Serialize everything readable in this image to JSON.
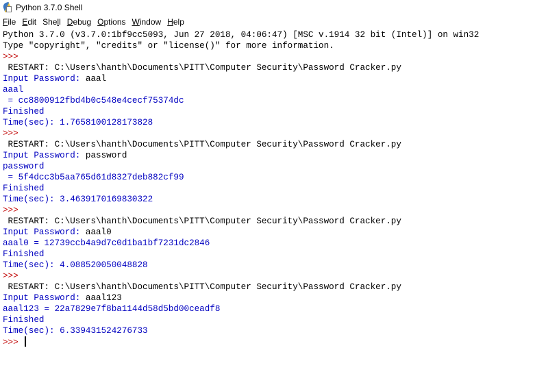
{
  "window": {
    "title": "Python 3.7.0 Shell",
    "icon": "python-idle-icon"
  },
  "menu": {
    "items": [
      {
        "pre": "",
        "key": "F",
        "post": "ile"
      },
      {
        "pre": "",
        "key": "E",
        "post": "dit"
      },
      {
        "pre": "She",
        "key": "l",
        "post": "l"
      },
      {
        "pre": "",
        "key": "D",
        "post": "ebug"
      },
      {
        "pre": "",
        "key": "O",
        "post": "ptions"
      },
      {
        "pre": "",
        "key": "W",
        "post": "indow"
      },
      {
        "pre": "",
        "key": "H",
        "post": "elp"
      }
    ]
  },
  "colors": {
    "stdout": "#0000c0",
    "prompt": "#c00000",
    "plain": "#000000",
    "background": "#ffffff"
  },
  "shell": {
    "lines": [
      {
        "text": "Python 3.7.0 (v3.7.0:1bf9cc5093, Jun 27 2018, 04:06:47) [MSC v.1914 32 bit (Intel)] on win32",
        "kind": "plain"
      },
      {
        "text": "Type \"copyright\", \"credits\" or \"license()\" for more information.",
        "kind": "plain"
      },
      {
        "text": ">>> ",
        "kind": "prompt"
      },
      {
        "text": " RESTART: C:\\Users\\hanth\\Documents\\PITT\\Computer Security\\Password Cracker.py",
        "kind": "plain"
      },
      {
        "text": "Input Password: ",
        "kind": "stdout",
        "input": "aaal"
      },
      {
        "text": "aaal",
        "kind": "stdout"
      },
      {
        "text": " = cc8800912fbd4b0c548e4cecf75374dc",
        "kind": "stdout"
      },
      {
        "text": "Finished",
        "kind": "stdout"
      },
      {
        "text": "Time(sec): 1.7658100128173828",
        "kind": "stdout"
      },
      {
        "text": ">>> ",
        "kind": "prompt"
      },
      {
        "text": " RESTART: C:\\Users\\hanth\\Documents\\PITT\\Computer Security\\Password Cracker.py",
        "kind": "plain"
      },
      {
        "text": "Input Password: ",
        "kind": "stdout",
        "input": "password"
      },
      {
        "text": "password",
        "kind": "stdout"
      },
      {
        "text": " = 5f4dcc3b5aa765d61d8327deb882cf99",
        "kind": "stdout"
      },
      {
        "text": "Finished",
        "kind": "stdout"
      },
      {
        "text": "Time(sec): 3.4639170169830322",
        "kind": "stdout"
      },
      {
        "text": ">>> ",
        "kind": "prompt"
      },
      {
        "text": " RESTART: C:\\Users\\hanth\\Documents\\PITT\\Computer Security\\Password Cracker.py",
        "kind": "plain"
      },
      {
        "text": "Input Password: ",
        "kind": "stdout",
        "input": "aaal0"
      },
      {
        "text": "aaal0 = 12739ccb4a9d7c0d1ba1bf7231dc2846",
        "kind": "stdout"
      },
      {
        "text": "Finished",
        "kind": "stdout"
      },
      {
        "text": "Time(sec): 4.088520050048828",
        "kind": "stdout"
      },
      {
        "text": ">>> ",
        "kind": "prompt"
      },
      {
        "text": " RESTART: C:\\Users\\hanth\\Documents\\PITT\\Computer Security\\Password Cracker.py",
        "kind": "plain"
      },
      {
        "text": "Input Password: ",
        "kind": "stdout",
        "input": "aaal123"
      },
      {
        "text": "aaal123 = 22a7829e7f8ba1144d58d5bd00ceadf8",
        "kind": "stdout"
      },
      {
        "text": "Finished",
        "kind": "stdout"
      },
      {
        "text": "Time(sec): 6.339431524276733",
        "kind": "stdout"
      }
    ],
    "final_prompt": ">>> "
  }
}
